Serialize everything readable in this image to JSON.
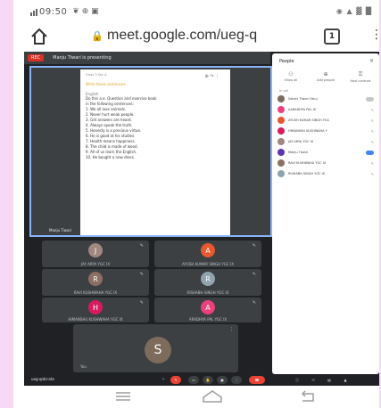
{
  "status_bar": {
    "time": "09:50",
    "carrier_icon": "signal-carrier-icon",
    "left_icons": "❦ ⊕ ▣",
    "right_icons": "◉ ▲ ▓ █"
  },
  "browser": {
    "url": "meet.google.com/ueg-q",
    "tab_count": "1",
    "home_icon": "home-icon",
    "menu_icon": "kebab-menu-icon"
  },
  "meet": {
    "recording_badge": "REC",
    "banner_text": "Manju Tiwari is presenting",
    "presenter_name": "Manju Tiwari",
    "document": {
      "header": "Class 3  Sec A",
      "highlight": "Write these sentences",
      "subheading": "English",
      "lines": [
        "Do this a.e. Question and exercise book",
        "in the following sentences:",
        "1. We all love animals.",
        "2. Never hurt weak people.",
        "3. Get answers are heard.",
        "4. Always speak the truth.",
        "5. Honesty is a precious virtue.",
        "6. He is good at his studies.",
        "7. Health means happiness.",
        "8. The child is made of wood.",
        "9. All of us learn the English.",
        "10. He bought a new dress."
      ]
    },
    "tiles": [
      {
        "initial": "J",
        "name": "JAY ARYA YGC IX",
        "color": "#a1887f"
      },
      {
        "initial": "A",
        "name": "AYUSH KUMAR SINGH YGC IX",
        "color": "#e8582e"
      },
      {
        "initial": "R",
        "name": "RAVI KUSHWAHA YGC IX",
        "color": "#8d6e63"
      },
      {
        "initial": "R",
        "name": "RISHABH SINGH YGC IX",
        "color": "#90a4ae"
      },
      {
        "initial": "H",
        "name": "HIMANSHU KUSHWAHA YGC IX",
        "color": "#d81b60"
      },
      {
        "initial": "A",
        "name": "ARADHYA PAL YGC IX",
        "color": "#ec407a"
      }
    ],
    "self_tile": {
      "initial": "S",
      "name": "You"
    },
    "people": {
      "title": "People",
      "actions": [
        {
          "label": "Show all",
          "icon": "people-icon"
        },
        {
          "label": "Add people",
          "icon": "add-person-icon"
        },
        {
          "label": "Host controls",
          "icon": "lock-icon"
        }
      ],
      "list_label": "In call",
      "participants": [
        {
          "name": "Sakshi Tiwari (You)",
          "color": "#7d6b5c",
          "status": "toggle"
        },
        {
          "name": "AARADHYA PAL IX",
          "color": "#ec407a",
          "status": "mic"
        },
        {
          "name": "AYUSH KUMAR SINGH YGC",
          "color": "#e8582e",
          "status": "mic"
        },
        {
          "name": "HIMANSHU KUSHWAHA Y",
          "color": "#d81b60",
          "status": "mic"
        },
        {
          "name": "JAY ARYA YGC IX",
          "color": "#a1887f",
          "status": "mic"
        },
        {
          "name": "Manju Tiwari",
          "color": "#5e35b1",
          "status": "speaking"
        },
        {
          "name": "RAVI KUSHWAHA YGC IX",
          "color": "#8d6e63",
          "status": "mic"
        },
        {
          "name": "RISHABH SINGH YGC IX",
          "color": "#90a4ae",
          "status": "mic"
        }
      ]
    },
    "meeting_code": "ueg-qnbr-ate"
  }
}
